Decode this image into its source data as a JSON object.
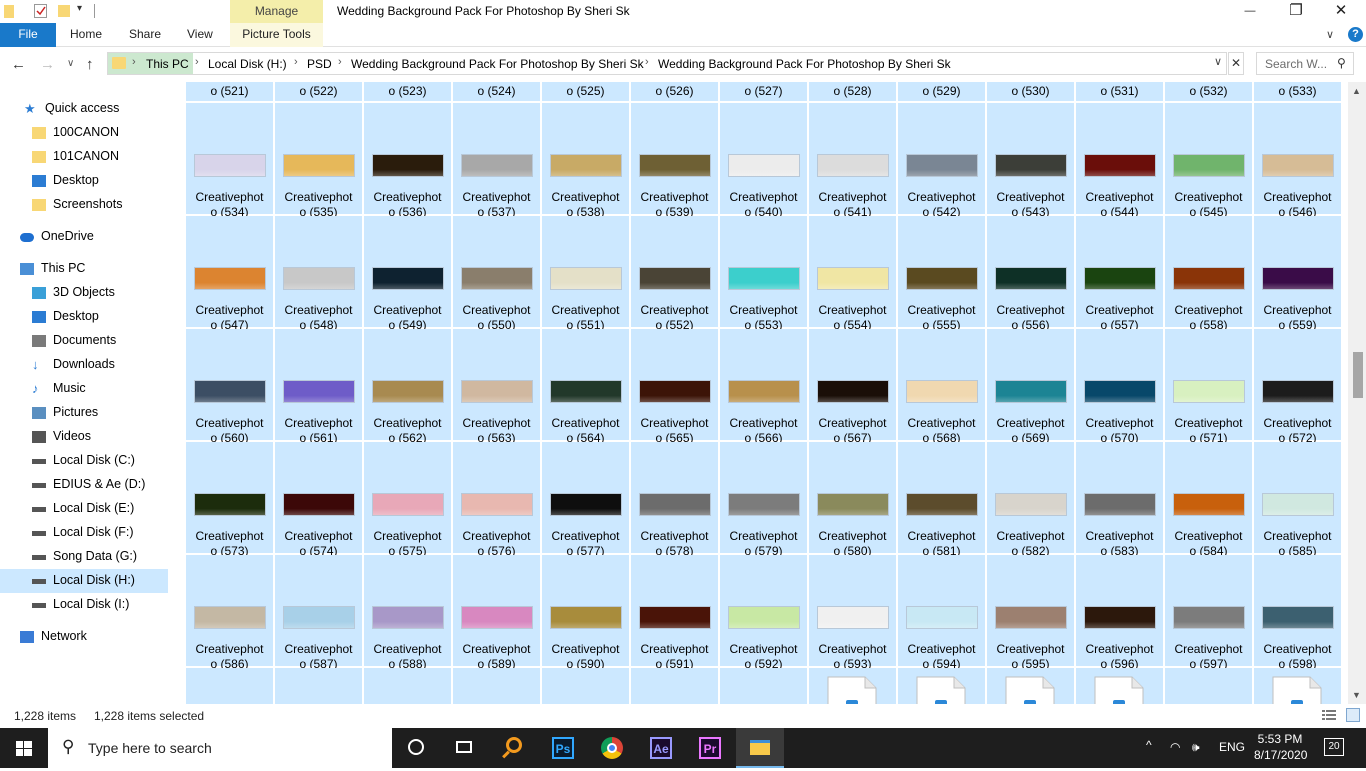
{
  "window": {
    "title": "Wedding Background Pack For Photoshop By Sheri Sk",
    "manage_label": "Manage",
    "minimize": "—",
    "maximize": "❐",
    "close": "✕"
  },
  "ribbon": {
    "tabs": [
      "File",
      "Home",
      "Share",
      "View",
      "Picture Tools"
    ],
    "help": "?",
    "collapse": "∨"
  },
  "address": {
    "crumbs": [
      "This PC",
      "Local Disk (H:)",
      "PSD",
      "Wedding Background Pack For Photoshop By Sheri Sk",
      "Wedding Background Pack For Photoshop By Sheri Sk"
    ],
    "search_placeholder": "Search W...",
    "nav_back": "←",
    "nav_forward": "→",
    "nav_recent": "∨",
    "nav_up": "↑"
  },
  "nav": {
    "items": [
      {
        "label": "Quick access",
        "icon": "star-icon"
      },
      {
        "label": "100CANON",
        "icon": "folder-icon"
      },
      {
        "label": "101CANON",
        "icon": "folder-icon"
      },
      {
        "label": "Desktop",
        "icon": "desktop-icon"
      },
      {
        "label": "Screenshots",
        "icon": "folder-icon"
      },
      {
        "label": "OneDrive",
        "icon": "cloud-icon"
      },
      {
        "label": "This PC",
        "icon": "computer-icon"
      },
      {
        "label": "3D Objects",
        "icon": "cube-icon"
      },
      {
        "label": "Desktop",
        "icon": "desktop-icon"
      },
      {
        "label": "Documents",
        "icon": "document-icon"
      },
      {
        "label": "Downloads",
        "icon": "download-icon"
      },
      {
        "label": "Music",
        "icon": "music-icon"
      },
      {
        "label": "Pictures",
        "icon": "pictures-icon"
      },
      {
        "label": "Videos",
        "icon": "video-icon"
      },
      {
        "label": "Local Disk (C:)",
        "icon": "drive-icon"
      },
      {
        "label": "EDIUS & Ae (D:)",
        "icon": "drive-icon"
      },
      {
        "label": "Local Disk (E:)",
        "icon": "drive-icon"
      },
      {
        "label": "Local Disk (F:)",
        "icon": "drive-icon"
      },
      {
        "label": "Song Data (G:)",
        "icon": "drive-icon"
      },
      {
        "label": "Local Disk (H:)",
        "icon": "drive-icon",
        "selected": true
      },
      {
        "label": "Local Disk (I:)",
        "icon": "drive-icon"
      },
      {
        "label": "Network",
        "icon": "network-icon"
      }
    ]
  },
  "files": {
    "name_prefix": "Creativephot",
    "top_row": [
      "o (521)",
      "o (522)",
      "o (523)",
      "o (524)",
      "o (525)",
      "o (526)",
      "o (527)",
      "o (528)",
      "o (529)",
      "o (530)",
      "o (531)",
      "o (532)",
      "o (533)"
    ],
    "rows": [
      {
        "names": [
          "o (534)",
          "o (535)",
          "o (536)",
          "o (537)",
          "o (538)",
          "o (539)",
          "o (540)",
          "o (541)",
          "o (542)",
          "o (543)",
          "o (544)",
          "o (545)",
          "o (546)"
        ],
        "colors": [
          "#d8d4ea",
          "#e6b85a",
          "#2a1c0c",
          "#a8a8a8",
          "#c8aa66",
          "#6e6034",
          "#ececec",
          "#dcdcdc",
          "#7a8694",
          "#3c3e38",
          "#6a0e0a",
          "#70b46c",
          "#d6bc96"
        ]
      },
      {
        "names": [
          "o (547)",
          "o (548)",
          "o (549)",
          "o (550)",
          "o (551)",
          "o (552)",
          "o (553)",
          "o (554)",
          "o (555)",
          "o (556)",
          "o (557)",
          "o (558)",
          "o (559)"
        ],
        "colors": [
          "#dc8430",
          "#c8c8c8",
          "#0e2230",
          "#8a7e6c",
          "#e4e0c8",
          "#4a4436",
          "#3ccfcc",
          "#f0e6a4",
          "#5a4a20",
          "#0e3026",
          "#1a4410",
          "#8a3408",
          "#3a0c48"
        ]
      },
      {
        "names": [
          "o (560)",
          "o (561)",
          "o (562)",
          "o (563)",
          "o (564)",
          "o (565)",
          "o (566)",
          "o (567)",
          "o (568)",
          "o (569)",
          "o (570)",
          "o (571)",
          "o (572)"
        ],
        "colors": [
          "#3c4e64",
          "#6e5cc8",
          "#a88a50",
          "#d0b8a0",
          "#22382a",
          "#3c1408",
          "#b8904c",
          "#1a0e08",
          "#f0d8b0",
          "#1c8494",
          "#08486a",
          "#d8f0c0",
          "#1c1c1c"
        ]
      },
      {
        "names": [
          "o (573)",
          "o (574)",
          "o (575)",
          "o (576)",
          "o (577)",
          "o (578)",
          "o (579)",
          "o (580)",
          "o (581)",
          "o (582)",
          "o (583)",
          "o (584)",
          "o (585)"
        ],
        "colors": [
          "#1c2c0c",
          "#3c0808",
          "#e8a8b8",
          "#e8b8b0",
          "#0e0e0e",
          "#6c6c6c",
          "#7c7c7c",
          "#8a8a5c",
          "#5c4c2c",
          "#d8d4cc",
          "#6c6c6c",
          "#c8600c",
          "#d0e8e0"
        ]
      },
      {
        "names": [
          "o (586)",
          "o (587)",
          "o (588)",
          "o (589)",
          "o (590)",
          "o (591)",
          "o (592)",
          "o (593)",
          "o (594)",
          "o (595)",
          "o (596)",
          "o (597)",
          "o (598)"
        ],
        "colors": [
          "#c4b8a4",
          "#a8d0e8",
          "#a898c8",
          "#d888c0",
          "#a88c3c",
          "#4a1408",
          "#c8e8a4",
          "#f0f0f0",
          "#c8e8f4",
          "#9c8070",
          "#2c180c",
          "#7c7c7c",
          "#3c6070"
        ]
      }
    ],
    "bottom_row_icons": [
      false,
      false,
      false,
      false,
      false,
      false,
      false,
      true,
      true,
      true,
      true,
      false,
      true
    ]
  },
  "status": {
    "count": "1,228 items",
    "selected": "1,228 items selected"
  },
  "taskbar": {
    "search_placeholder": "Type here to search",
    "apps": [
      "Ps",
      "Ae",
      "Pr"
    ],
    "language": "ENG",
    "time": "5:53 PM",
    "date": "8/17/2020",
    "notifications": "20"
  }
}
